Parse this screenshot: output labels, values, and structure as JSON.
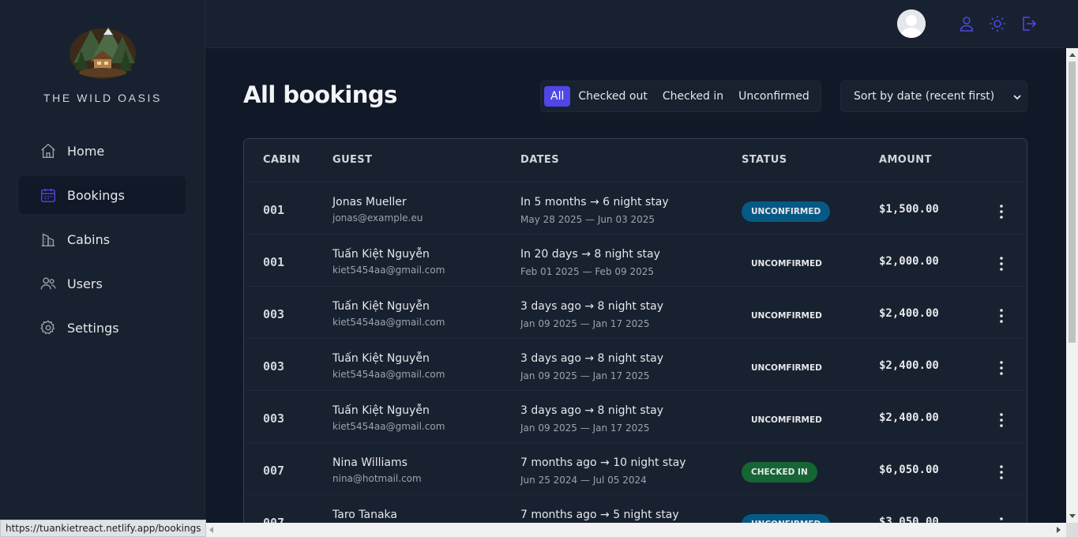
{
  "app": {
    "name": "THE WILD OASIS",
    "status_url": "https://tuankietreact.netlify.app/bookings"
  },
  "sidebar": {
    "items": [
      {
        "label": "Home",
        "icon": "home-icon",
        "active": false
      },
      {
        "label": "Bookings",
        "icon": "calendar-icon",
        "active": true
      },
      {
        "label": "Cabins",
        "icon": "buildings-icon",
        "active": false
      },
      {
        "label": "Users",
        "icon": "users-icon",
        "active": false
      },
      {
        "label": "Settings",
        "icon": "gear-icon",
        "active": false
      }
    ]
  },
  "header": {
    "icons": [
      "avatar",
      "user-icon",
      "sun-icon",
      "logout-icon"
    ]
  },
  "main": {
    "title": "All bookings",
    "filters": [
      {
        "label": "All",
        "active": true
      },
      {
        "label": "Checked out",
        "active": false
      },
      {
        "label": "Checked in",
        "active": false
      },
      {
        "label": "Unconfirmed",
        "active": false
      }
    ],
    "sort": {
      "selected": "Sort by date (recent first)"
    }
  },
  "table": {
    "headers": [
      "CABIN",
      "GUEST",
      "DATES",
      "STATUS",
      "AMOUNT"
    ],
    "rows": [
      {
        "cabin": "001",
        "guest": "Jonas Mueller",
        "email": "jonas@example.eu",
        "dates_rel": "In 5 months → 6 night stay",
        "dates_abs": "May 28 2025 — Jun 03 2025",
        "status": "UNCONFIRMED",
        "badge": "blue",
        "amount": "$1,500.00"
      },
      {
        "cabin": "001",
        "guest": "Tuấn Kiệt Nguyễn",
        "email": "kiet5454aa@gmail.com",
        "dates_rel": "In 20 days → 8 night stay",
        "dates_abs": "Feb 01 2025 — Feb 09 2025",
        "status": "UNCOMFIRMED",
        "badge": "none",
        "amount": "$2,000.00"
      },
      {
        "cabin": "003",
        "guest": "Tuấn Kiệt Nguyễn",
        "email": "kiet5454aa@gmail.com",
        "dates_rel": "3 days ago → 8 night stay",
        "dates_abs": "Jan 09 2025 — Jan 17 2025",
        "status": "UNCOMFIRMED",
        "badge": "none",
        "amount": "$2,400.00"
      },
      {
        "cabin": "003",
        "guest": "Tuấn Kiệt Nguyễn",
        "email": "kiet5454aa@gmail.com",
        "dates_rel": "3 days ago → 8 night stay",
        "dates_abs": "Jan 09 2025 — Jan 17 2025",
        "status": "UNCOMFIRMED",
        "badge": "none",
        "amount": "$2,400.00"
      },
      {
        "cabin": "003",
        "guest": "Tuấn Kiệt Nguyễn",
        "email": "kiet5454aa@gmail.com",
        "dates_rel": "3 days ago → 8 night stay",
        "dates_abs": "Jan 09 2025 — Jan 17 2025",
        "status": "UNCOMFIRMED",
        "badge": "none",
        "amount": "$2,400.00"
      },
      {
        "cabin": "007",
        "guest": "Nina Williams",
        "email": "nina@hotmail.com",
        "dates_rel": "7 months ago → 10 night stay",
        "dates_abs": "Jun 25 2024 — Jul 05 2024",
        "status": "CHECKED IN",
        "badge": "green",
        "amount": "$6,050.00"
      },
      {
        "cabin": "007",
        "guest": "Taro Tanaka",
        "email": "",
        "dates_rel": "7 months ago → 5 night stay",
        "dates_abs": "",
        "status": "UNCONFIRMED",
        "badge": "blue",
        "amount": "$3,050.00"
      }
    ]
  },
  "colors": {
    "accent": "#4f46e5",
    "badge_blue": "#075985",
    "badge_green": "#166534"
  }
}
